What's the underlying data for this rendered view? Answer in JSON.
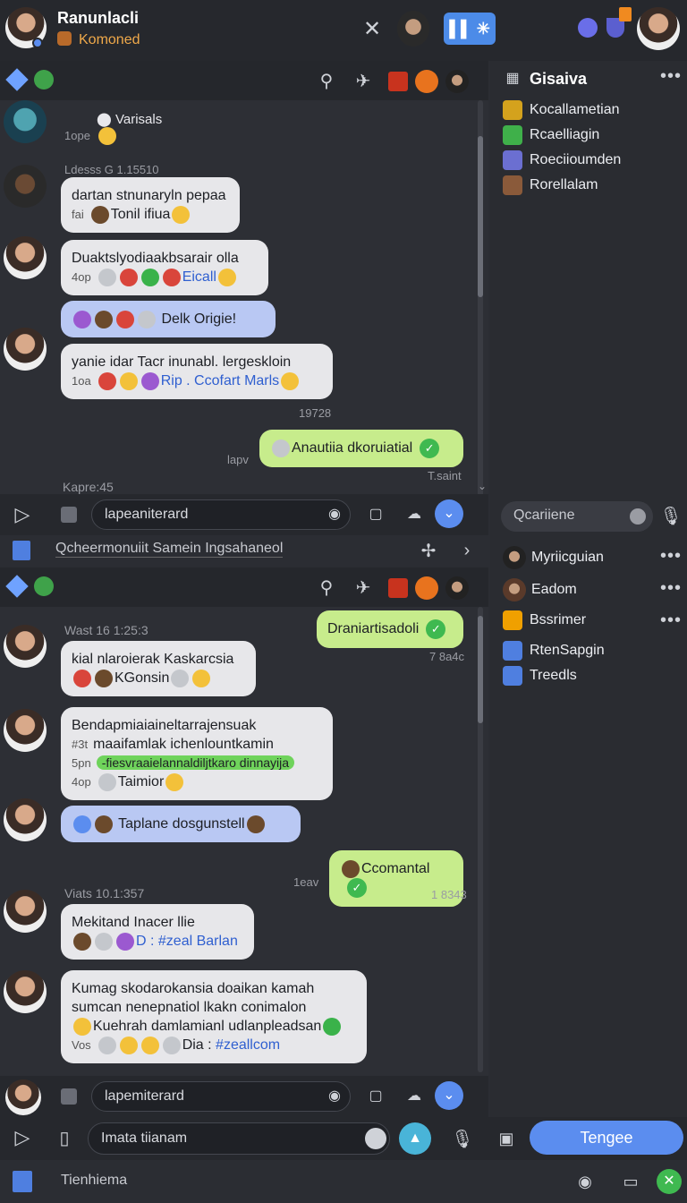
{
  "header": {
    "title": "Ranunlacli",
    "subtitle": "Komoned"
  },
  "sidebar_top": {
    "title": "Gisaiva",
    "items": [
      {
        "label": "Kocallametian",
        "color": "#d4a21d"
      },
      {
        "label": "Rcaelliagin",
        "color": "#3fb04a"
      },
      {
        "label": "Roeciioumden",
        "color": "#6b6fd1"
      },
      {
        "label": "Rorellalam",
        "color": "#8a5a3a"
      }
    ],
    "search_placeholder": "Qcariiene"
  },
  "sidebar_bottom": {
    "items": [
      {
        "label": "Myriicguian",
        "color": "#333"
      },
      {
        "label": "Eadom",
        "color": "#7b5a3a"
      },
      {
        "label": "Bssrimer",
        "color": "#f0a000"
      },
      {
        "label": "RtenSapgin",
        "color": "#4f7fe0"
      },
      {
        "label": "Treedls",
        "color": "#4f7fe0"
      }
    ]
  },
  "pane1": {
    "first_name": "Varisals",
    "first_meta": "1ope",
    "messages": [
      {
        "stamp": "Ldesss G 1.15510",
        "text": "dartan stnunaryln pepaa",
        "line2_meta": "fai",
        "line2_text": "Tonil ifiua"
      },
      {
        "text": "Duaktslyodiaakbsarair olla",
        "line2_meta": "4op",
        "line2_link": "Eicall"
      },
      {
        "text": "Delk Origie!"
      },
      {
        "text": "yanie idar Tacr inunabl. lergeskloin",
        "line2_meta": "1oa",
        "line2_link": "Rip . Ccofart Marls",
        "after": "19728"
      },
      {
        "text": "Anautiia dkoruiatial",
        "meta_left": "lapv",
        "meta_right": "T.saint"
      }
    ],
    "time_footer": "Kapre:45",
    "input_placeholder": "lapeaniterard",
    "sub_bar_text": "Qcheermonuiit Samein Ingsahaneol"
  },
  "pane2": {
    "messages": [
      {
        "text": "Draniartisadoli",
        "meta_right": "7 8a4c"
      },
      {
        "stamp": "Wast 16 1:25:3",
        "text": "kial nlaroierak Kaskarcsia",
        "line2_text": "KGonsin"
      },
      {
        "text": "Bendapmiaiaineltarrajensuak",
        "line2_text": "maaifamlak ichenlountkamin",
        "line2_meta": "#3t",
        "highlight": "-fiesvraaielannaldiljtkaro dinnayija",
        "hl_meta": "5pn",
        "line4_meta": "4op",
        "line4_text": "Taimior"
      },
      {
        "text": "Taplane dosgunstell"
      },
      {
        "text": "Ccomantal",
        "meta_left": "1eav",
        "meta_right": "1 8343"
      },
      {
        "stamp": "Viats 10.1:357",
        "text": "Mekitand Inacer llie",
        "line2_link": "D : #zeal Barlan"
      },
      {
        "text": "Kumag skodarokansia doaikan kamah",
        "line2_text": "sumcan nenepnatiol lkakn conimalon",
        "line3_text": "Kuehrah damlamianl udlanpleadsan",
        "line4_meta": "Vos",
        "line4_text": "Dia :",
        "line4_link": "#zeallcom"
      }
    ],
    "input_placeholder": "lapemiterard"
  },
  "composer": {
    "placeholder": "Imata tiianam",
    "send_label": "Tengee"
  },
  "footer": {
    "label": "Tienhiema"
  }
}
